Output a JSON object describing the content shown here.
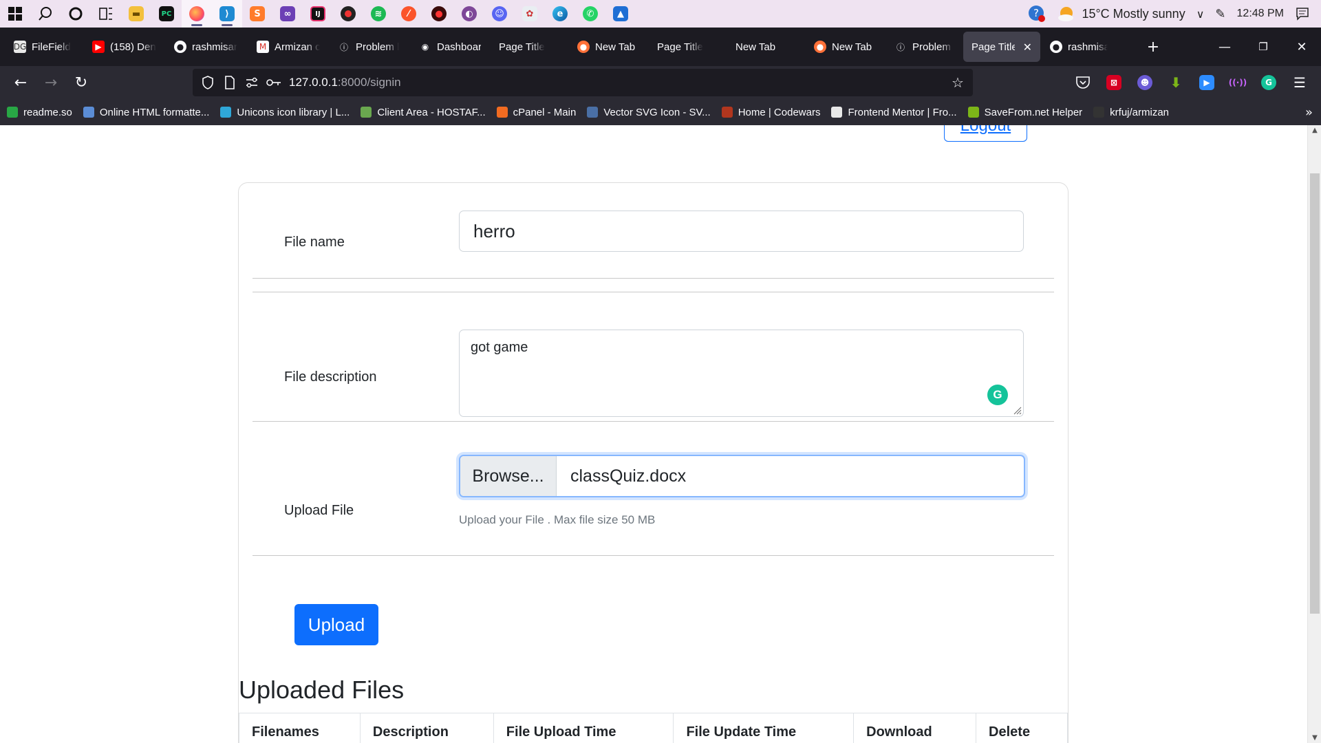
{
  "taskbar": {
    "apps": [
      {
        "name": "start-icon"
      },
      {
        "name": "search-icon"
      },
      {
        "name": "cortana-icon"
      },
      {
        "name": "task-view-icon"
      },
      {
        "name": "file-explorer-icon"
      },
      {
        "name": "pycharm-icon"
      },
      {
        "name": "firefox-icon"
      },
      {
        "name": "vscode-icon"
      },
      {
        "name": "sublime-icon"
      },
      {
        "name": "visual-studio-icon"
      },
      {
        "name": "intellij-icon"
      },
      {
        "name": "record-icon"
      },
      {
        "name": "spotify-icon"
      },
      {
        "name": "brave-icon"
      },
      {
        "name": "davinci-icon"
      },
      {
        "name": "tor-icon"
      },
      {
        "name": "discord-icon"
      },
      {
        "name": "paint-icon"
      },
      {
        "name": "edge-icon"
      },
      {
        "name": "whatsapp-icon"
      },
      {
        "name": "photos-icon"
      }
    ],
    "weather": "15°C  Mostly sunny",
    "clock": "12:48 PM"
  },
  "tabs": [
    {
      "title": "FileField",
      "favicon": "dg-icon"
    },
    {
      "title": "(158) Den",
      "favicon": "youtube-icon"
    },
    {
      "title": "rashmisar",
      "favicon": "github-icon"
    },
    {
      "title": "Armizan c",
      "favicon": "gmail-icon"
    },
    {
      "title": "Problem l",
      "favicon": "info-icon"
    },
    {
      "title": "Dashboar",
      "favicon": "circle-icon"
    },
    {
      "title": "Page Title",
      "favicon": ""
    },
    {
      "title": "New Tab",
      "favicon": "firefox-icon"
    },
    {
      "title": "Page Title",
      "favicon": ""
    },
    {
      "title": "New Tab",
      "favicon": ""
    },
    {
      "title": "New Tab",
      "favicon": "firefox-icon"
    },
    {
      "title": "Problem l",
      "favicon": "info-icon"
    },
    {
      "title": "Page Title",
      "favicon": "",
      "active": true
    },
    {
      "title": "rashmisar",
      "favicon": "github-icon"
    }
  ],
  "address": {
    "host": "127.0.0.1",
    "path": ":8000/signin"
  },
  "bookmarks": [
    {
      "label": "readme.so",
      "color": "#28a745"
    },
    {
      "label": "Online HTML formatte...",
      "color": "#5b8dd6"
    },
    {
      "label": "Unicons icon library | L...",
      "color": "#2fa7d8"
    },
    {
      "label": "Client Area - HOSTAF...",
      "color": "#6aa84f"
    },
    {
      "label": "cPanel - Main",
      "color": "#f26b21"
    },
    {
      "label": "Vector SVG Icon - SV...",
      "color": "#4a6fa5"
    },
    {
      "label": "Home | Codewars",
      "color": "#b1361e"
    },
    {
      "label": "Frontend Mentor | Fro...",
      "color": "#e8e8e8"
    },
    {
      "label": "SaveFrom.net Helper",
      "color": "#7cb518"
    },
    {
      "label": "krfuj/armizan",
      "color": "#333333"
    }
  ],
  "page": {
    "logout_label": "Logout",
    "form": {
      "file_name_label": "File name",
      "file_name_value": "herro",
      "file_description_label": "File description",
      "file_description_value": "got game",
      "upload_file_label": "Upload File",
      "browse_label": "Browse...",
      "selected_file": "classQuiz.docx",
      "help_text": "Upload your File . Max file size 50 MB",
      "upload_button": "Upload"
    },
    "uploaded_title": "Uploaded Files",
    "table_headers": [
      "Filenames",
      "Description",
      "File Upload Time",
      "File Update Time",
      "Download",
      "Delete"
    ]
  },
  "colors": {
    "primary": "#0d6efd",
    "browser_dark": "#1c1b22",
    "toolbar": "#2b2a33",
    "taskbar": "#efe3f1"
  }
}
